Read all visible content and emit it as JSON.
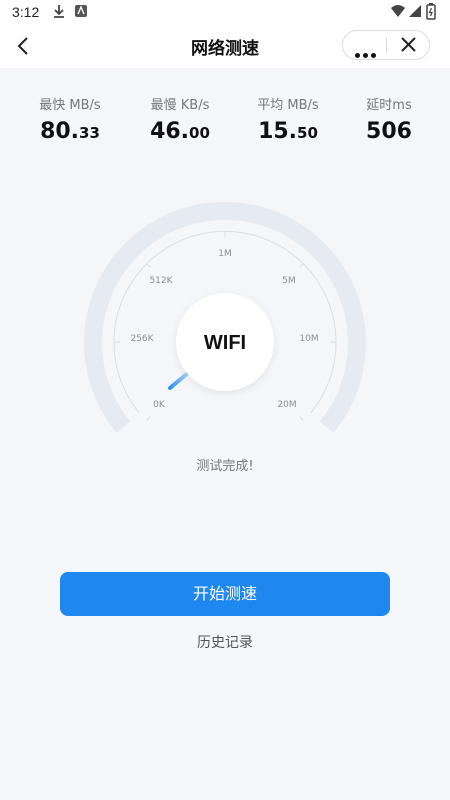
{
  "status_bar": {
    "time": "3:12",
    "icons": [
      "download-icon",
      "app-notification-icon",
      "wifi-signal-icon",
      "cell-signal-icon",
      "battery-icon"
    ]
  },
  "nav": {
    "title": "网络测速",
    "back_icon": "chevron-left-icon",
    "more_icon": "more-dots-icon",
    "close_icon": "close-icon"
  },
  "stats": [
    {
      "label": "最快 MB/s",
      "int": "80.",
      "dec": "33"
    },
    {
      "label": "最慢 KB/s",
      "int": "46.",
      "dec": "00"
    },
    {
      "label": "平均 MB/s",
      "int": "15.",
      "dec": "50"
    },
    {
      "label": "延时ms",
      "int": "506",
      "dec": ""
    }
  ],
  "gauge": {
    "center_label": "WIFI",
    "ticks": [
      "0K",
      "256K",
      "512K",
      "1M",
      "5M",
      "10M",
      "20M"
    ],
    "needle_position": 0,
    "colors": {
      "track": "#e6ebf1",
      "needle": "#2f8ff0",
      "ticks": "#d9dee5"
    }
  },
  "status_text": "测试完成!",
  "start_button": "开始测速",
  "history_link": "历史记录",
  "colors": {
    "accent": "#1e87f0",
    "background": "#f4f6f9"
  }
}
